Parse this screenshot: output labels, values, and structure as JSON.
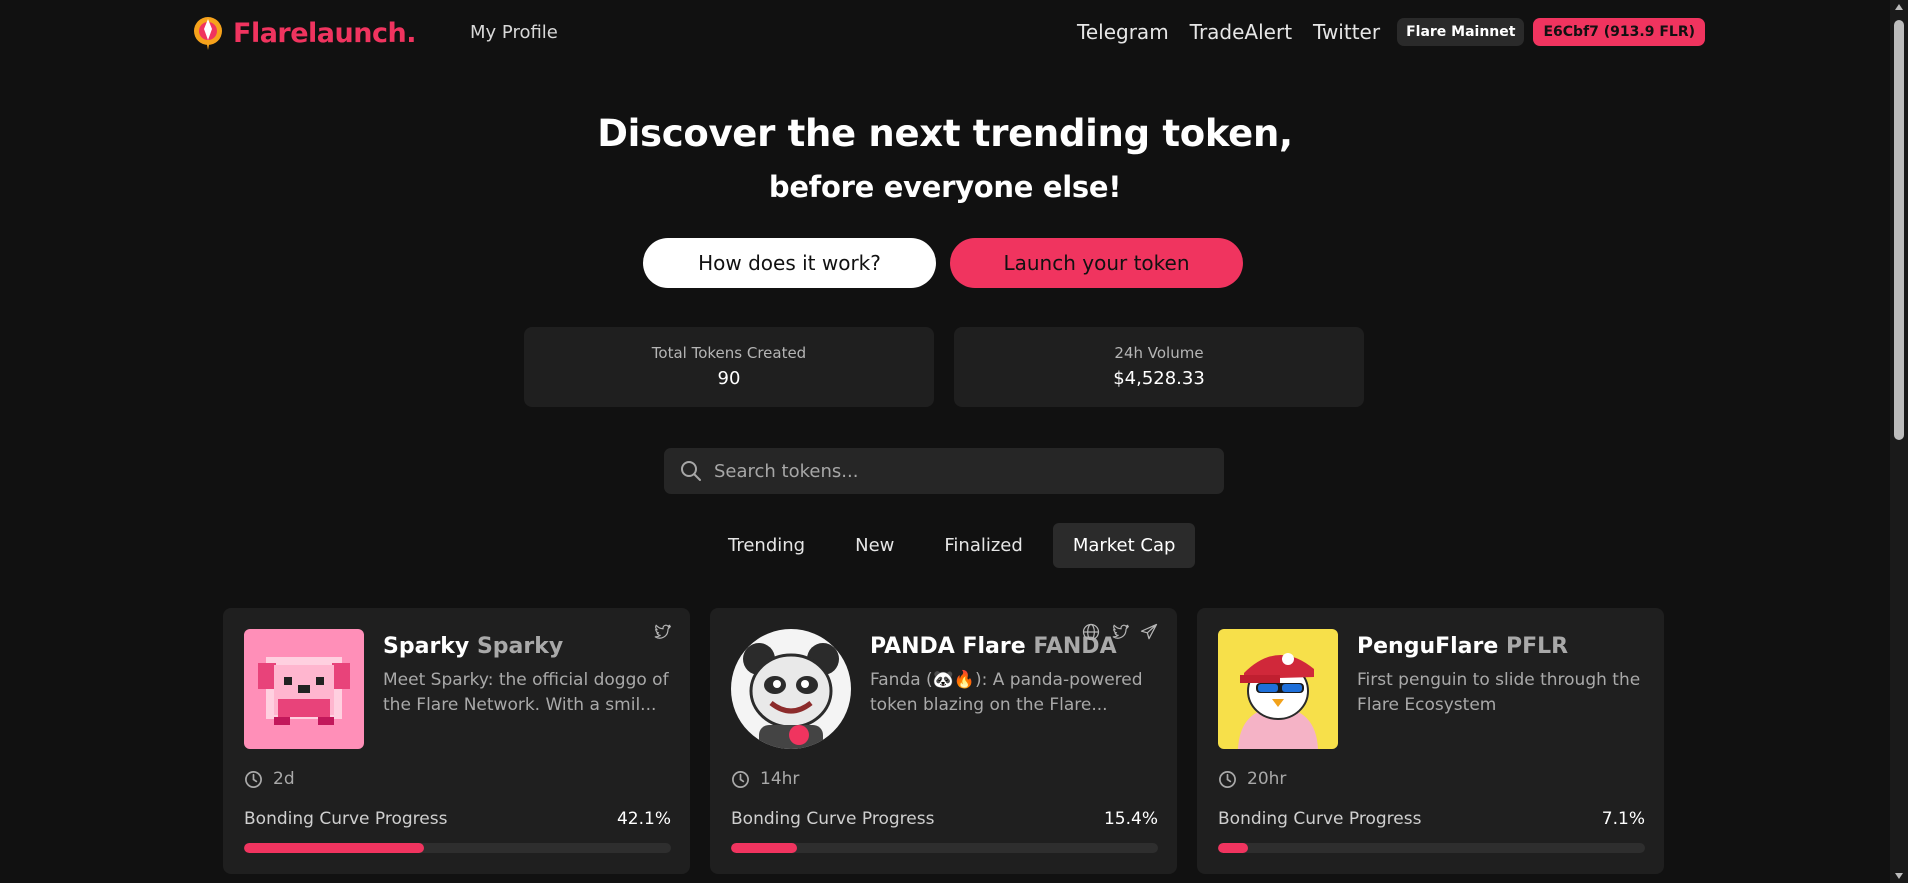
{
  "nav": {
    "brand": "Flarelaunch.",
    "my_profile": "My Profile",
    "links": [
      "Telegram",
      "TradeAlert",
      "Twitter"
    ],
    "network": "Flare Mainnet",
    "wallet": "E6Cbf7 (913.9 FLR)"
  },
  "hero": {
    "title": "Discover the next trending token,",
    "subtitle": "before everyone else!",
    "how_button": "How does it work?",
    "launch_button": "Launch your token"
  },
  "stats": {
    "total_tokens_label": "Total Tokens Created",
    "total_tokens_value": "90",
    "volume_label": "24h Volume",
    "volume_value": "$4,528.33"
  },
  "search": {
    "placeholder": "Search tokens..."
  },
  "tabs": [
    "Trending",
    "New",
    "Finalized",
    "Market Cap"
  ],
  "active_tab": "Market Cap",
  "colors": {
    "accent": "#f0345f",
    "background": "#111111",
    "card": "#1f1f1f"
  },
  "tokens": [
    {
      "name": "Sparky",
      "symbol": "Sparky",
      "description": "Meet Sparky: the official doggo of the Flare Network. With a smil...",
      "age": "2d",
      "progress_label": "Bonding Curve Progress",
      "progress_text": "42.1%",
      "progress": 42.1,
      "socials": [
        "twitter-icon"
      ]
    },
    {
      "name": "PANDA Flare",
      "symbol": "FANDA",
      "description": "Fanda (🐼🔥): A panda-powered token blazing on the Flare...",
      "age": "14hr",
      "progress_label": "Bonding Curve Progress",
      "progress_text": "15.4%",
      "progress": 15.4,
      "socials": [
        "globe-icon",
        "twitter-icon",
        "telegram-icon"
      ]
    },
    {
      "name": "PenguFlare",
      "symbol": "PFLR",
      "description": "First penguin to slide through the Flare Ecosystem",
      "age": "20hr",
      "progress_label": "Bonding Curve Progress",
      "progress_text": "7.1%",
      "progress": 7.1,
      "socials": []
    }
  ]
}
